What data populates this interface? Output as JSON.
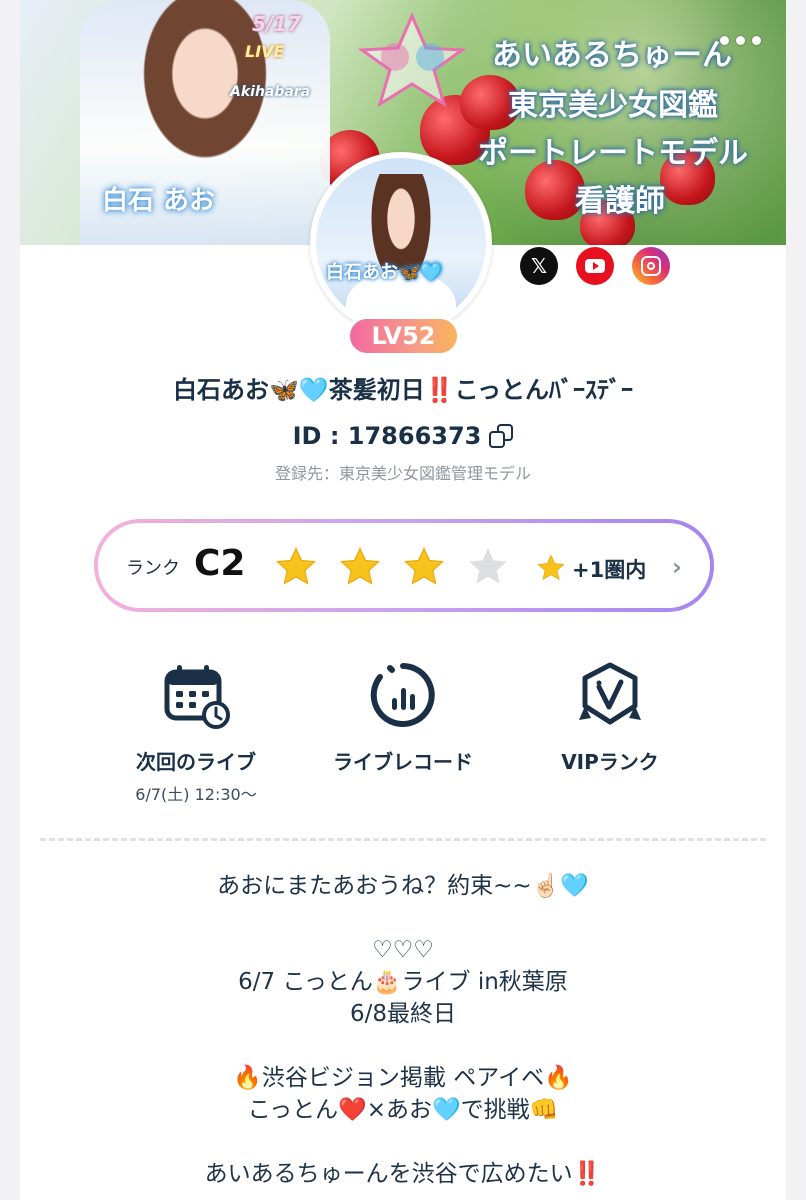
{
  "banner": {
    "date": "5/17",
    "live": "LIVE",
    "place": "Akihabara",
    "name": "白石 あお",
    "lines": [
      "あいあるちゅーん",
      "東京美少女図鑑",
      "ポートレートモデル",
      "看護師"
    ]
  },
  "avatar": {
    "caption": "白石あお🦋🩵"
  },
  "level": "LV52",
  "social": {
    "x_label": "𝕏"
  },
  "profile": {
    "name": "白石あお🦋🩵茶髪初日‼️こっとんﾊﾞｰｽﾃﾞｰ",
    "id": "ID : 17866373",
    "registered": "登録先：東京美少女図鑑管理モデル"
  },
  "rank": {
    "label": "ランク",
    "value": "C2",
    "stars_filled": 3,
    "stars_total": 4,
    "sub": "+1圏内",
    "chevron": "›"
  },
  "actions": {
    "next_live_label": "次回のライブ",
    "next_live_date": "6/7(土) 12:30〜",
    "record_label": "ライブレコード",
    "vip_label": "VIPランク"
  },
  "bio": [
    "あおにまたあおうね？約束~~☝🏻🩵",
    "",
    "♡♡♡",
    "6/7 こっとん🎂ライブ in秋葉原",
    "6/8最終日",
    "",
    "🔥渋谷ビジョン掲載 ペアイベ🔥",
    "こっとん❤️×あお🩵で挑戦👊",
    "",
    "あいあるちゅーんを渋谷で広めたい‼️"
  ],
  "colors": {
    "text": "#1a3046",
    "level_gradient": [
      "#f26aa0",
      "#f9b45a"
    ],
    "rank_border": [
      "#f3b1d9",
      "#a585f0"
    ],
    "star_filled": "#f7c21c",
    "star_empty": "#d6d8db"
  }
}
